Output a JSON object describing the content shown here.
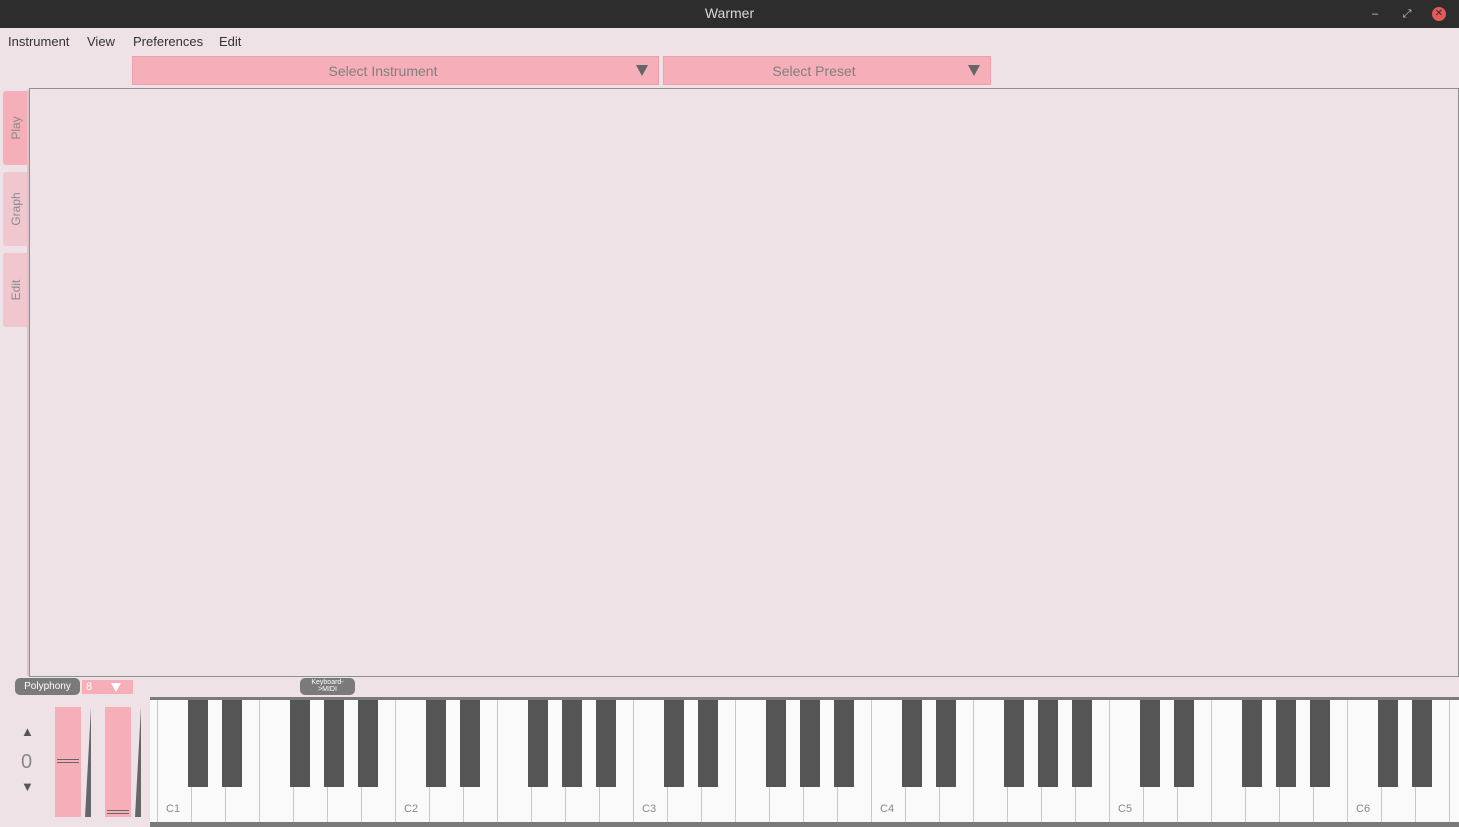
{
  "window": {
    "title": "Warmer"
  },
  "menu": [
    "Instrument",
    "View",
    "Preferences",
    "Edit"
  ],
  "selectors": {
    "instrument": "Select Instrument",
    "preset": "Select Preset"
  },
  "tabs": [
    "Play",
    "Graph",
    "Edit"
  ],
  "active_tab": "Play",
  "controls": {
    "polyphony_label": "Polyphony",
    "polyphony_value": "8",
    "keyboard_midi_label_line1": "Keyboard-",
    "keyboard_midi_label_line2": ">MIDI",
    "octave_up": "▲",
    "octave_value": "0",
    "octave_down": "▼"
  },
  "keyboard": {
    "octave_labels": [
      "C1",
      "C2",
      "C3",
      "C4",
      "C5",
      "C6"
    ]
  },
  "colors": {
    "accent": "#f6aeb8",
    "background": "#efe2e6",
    "titlebar": "#2d2d2d",
    "close_button": "#e35a5a"
  }
}
